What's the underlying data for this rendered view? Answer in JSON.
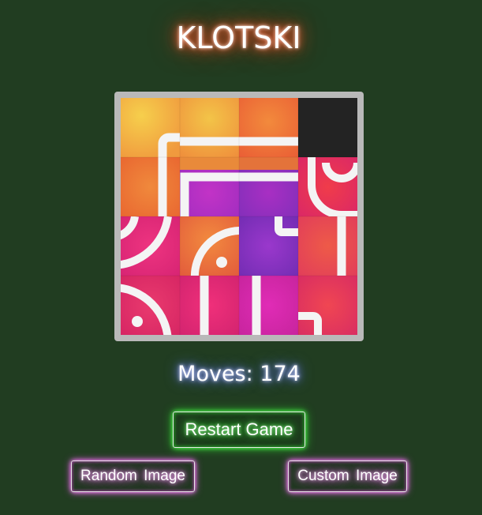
{
  "game": {
    "title": "KLOTSKI",
    "moves_label": "Moves: 174",
    "moves": 174
  },
  "puzzle": {
    "grid_size": 4,
    "image": "instagram-style logo gradient",
    "empty_tile": "top-right",
    "colors": {
      "yellow": "#f4c54a",
      "orange": "#f07638",
      "pink": "#e0287a",
      "magenta": "#c22bb8",
      "purple": "#8a2fc0",
      "empty": "#232323",
      "frame": "#b9b9b9"
    }
  },
  "buttons": {
    "restart": "Restart Game",
    "random_image": "Random Image",
    "custom_image": "Custom Image"
  },
  "colors": {
    "background": "#213d21",
    "title_glow": "#ff4a20",
    "moves_glow": "#5a6aff",
    "restart_glow": "#2fd12f",
    "image_buttons_glow": "#d24fd2"
  }
}
